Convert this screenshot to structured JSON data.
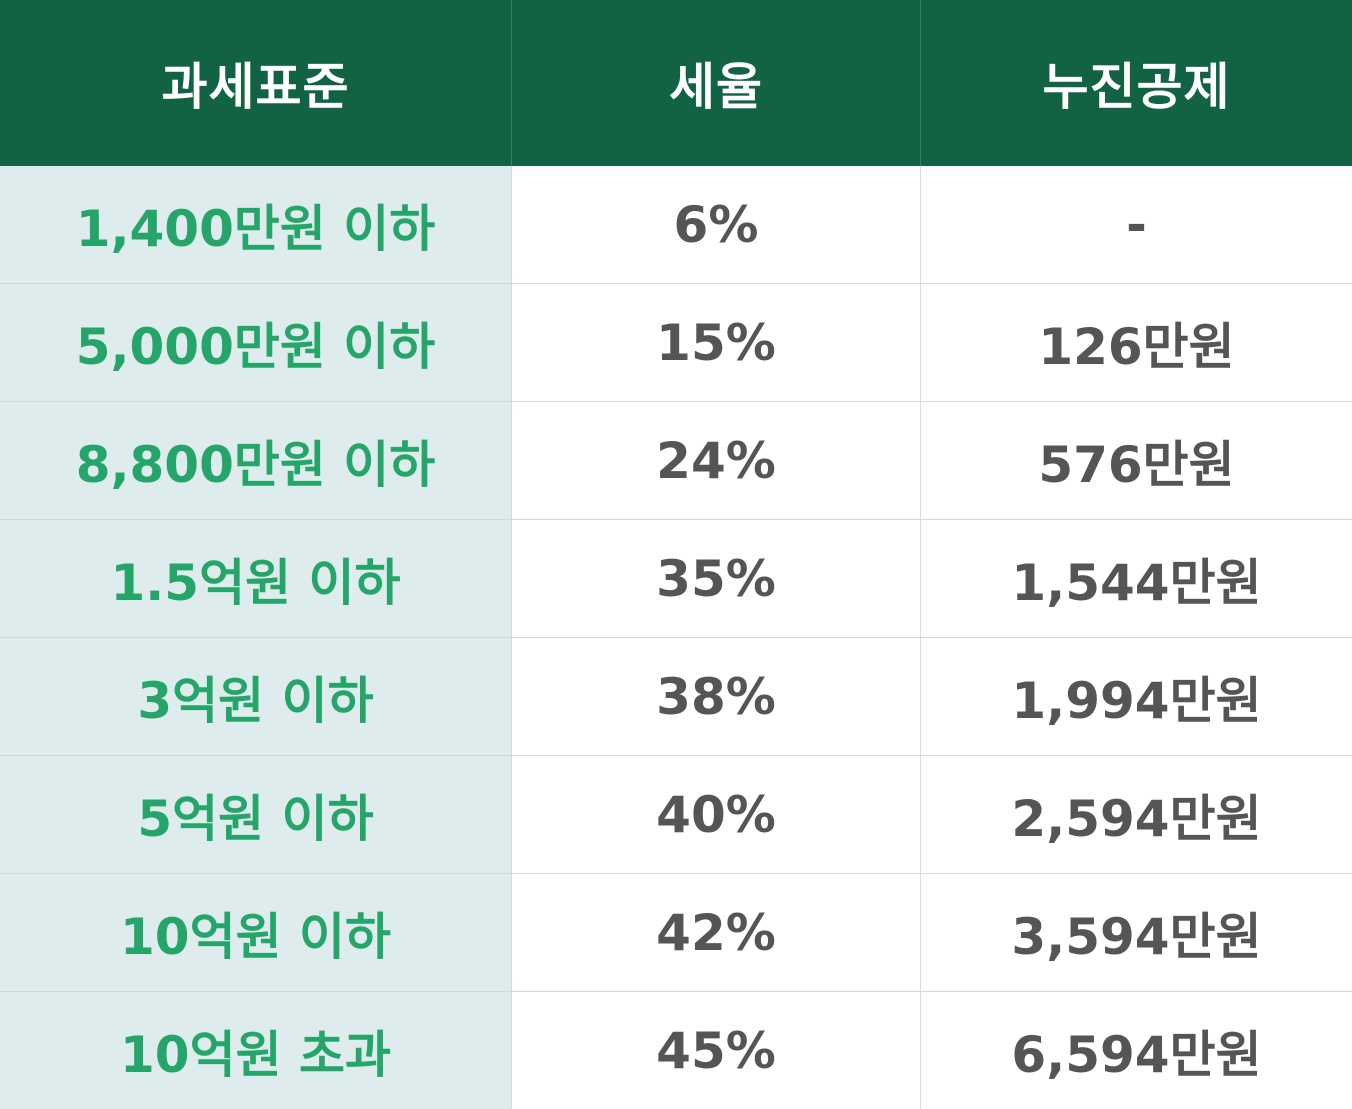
{
  "colors": {
    "header_bg": "#116343",
    "bracket_text": "#25a56a",
    "bracket_bg": "#dfeced",
    "value_text": "#555555"
  },
  "table": {
    "headers": [
      "과세표준",
      "세율",
      "누진공제"
    ],
    "rows": [
      {
        "bracket": "1,400만원 이하",
        "rate": "6%",
        "deduction": "-"
      },
      {
        "bracket": "5,000만원 이하",
        "rate": "15%",
        "deduction": "126만원"
      },
      {
        "bracket": "8,800만원 이하",
        "rate": "24%",
        "deduction": "576만원"
      },
      {
        "bracket": "1.5억원 이하",
        "rate": "35%",
        "deduction": "1,544만원"
      },
      {
        "bracket": "3억원 이하",
        "rate": "38%",
        "deduction": "1,994만원"
      },
      {
        "bracket": "5억원 이하",
        "rate": "40%",
        "deduction": "2,594만원"
      },
      {
        "bracket": "10억원 이하",
        "rate": "42%",
        "deduction": "3,594만원"
      },
      {
        "bracket": "10억원 초과",
        "rate": "45%",
        "deduction": "6,594만원"
      }
    ]
  }
}
